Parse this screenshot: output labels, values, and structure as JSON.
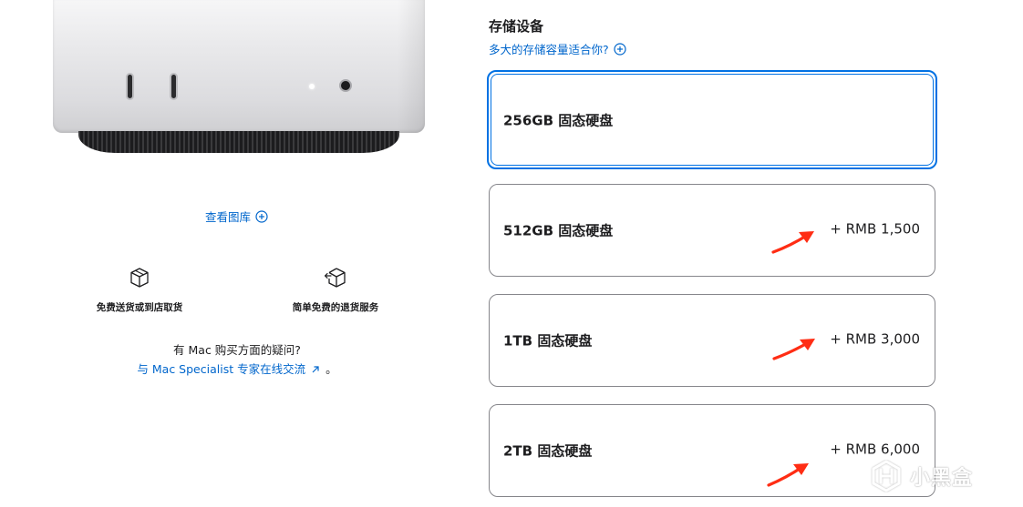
{
  "product": {
    "gallery_link": "查看图库"
  },
  "features": [
    {
      "icon": "box-icon",
      "label": "免费送货或到店取货"
    },
    {
      "icon": "return-box-icon",
      "label": "简单免费的退货服务"
    }
  ],
  "help": {
    "question": "有 Mac 购买方面的疑问?",
    "contact_link": "与 Mac Specialist 专家在线交流",
    "contact_suffix": "。"
  },
  "storage": {
    "title": "存储设备",
    "help_link": "多大的存储容量适合你?",
    "options": [
      {
        "label": "256GB 固态硬盘",
        "price": "",
        "selected": true
      },
      {
        "label": "512GB 固态硬盘",
        "price": "+ RMB 1,500",
        "selected": false
      },
      {
        "label": "1TB 固态硬盘",
        "price": "+ RMB 3,000",
        "selected": false
      },
      {
        "label": "2TB 固态硬盘",
        "price": "+ RMB 6,000",
        "selected": false
      }
    ]
  },
  "colors": {
    "link": "#0066cc",
    "selected_border": "#0071e3",
    "option_border": "#86868b",
    "arrow": "#ff2d14"
  },
  "watermark": {
    "text": "小黑盒"
  }
}
